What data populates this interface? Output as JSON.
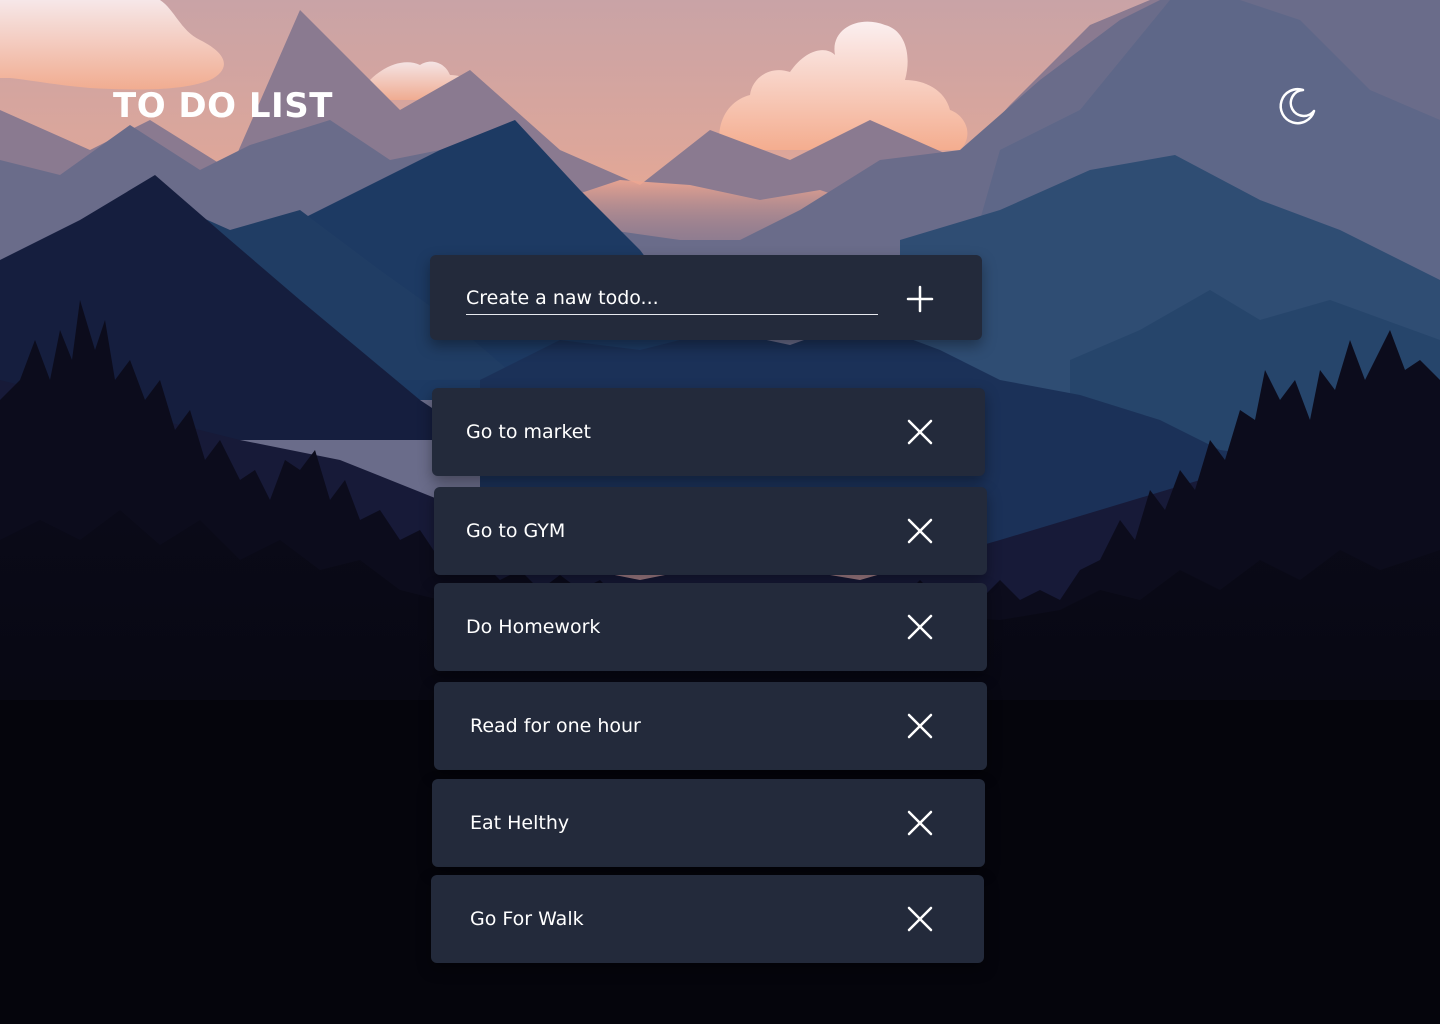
{
  "app": {
    "title": "TO DO LIST"
  },
  "header": {
    "theme_toggle_icon": "moon-icon"
  },
  "new_todo": {
    "placeholder": "Create a naw todo...",
    "value": "",
    "add_icon": "plus-icon"
  },
  "todos": [
    {
      "label": "Go to market",
      "delete_icon": "close-icon"
    },
    {
      "label": "Go to GYM",
      "delete_icon": "close-icon"
    },
    {
      "label": "Do Homework",
      "delete_icon": "close-icon"
    },
    {
      "label": "Read for one hour",
      "delete_icon": "close-icon"
    },
    {
      "label": "Eat Helthy",
      "delete_icon": "close-icon"
    },
    {
      "label": "Go For Walk",
      "delete_icon": "close-icon"
    }
  ],
  "colors": {
    "card_background": "#232a3b",
    "text": "#ffffff",
    "sky_top": "#c9a7a8",
    "sky_glow": "#f3aa8c",
    "night_foreground": "#05050c"
  }
}
